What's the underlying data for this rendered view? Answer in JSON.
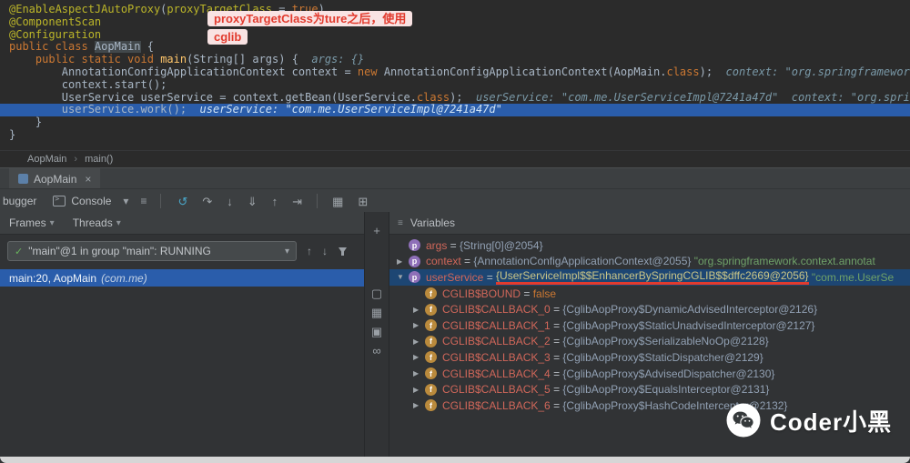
{
  "colors": {
    "current_line": "#2a5dab",
    "selected_row": "#1d4673",
    "annotation_red": "#e23b2e",
    "callout_bg": "#f9e3e3",
    "keyword_orange": "#cc7832",
    "annotation_yellow": "#bbb529",
    "var_name": "#d1675a"
  },
  "icons": {
    "chevron_down": "▾",
    "hamburger": "≡",
    "close": "×",
    "check": "✓",
    "up": "↑",
    "down": "↓"
  },
  "editor": {
    "current_line": 8,
    "lines": [
      [
        {
          "t": "@EnableAspectJAutoProxy",
          "c": "ann"
        },
        {
          "t": "(",
          "c": "plain"
        },
        {
          "t": "proxyTargetClass",
          "c": "ann"
        },
        {
          "t": " = ",
          "c": "plain"
        },
        {
          "t": "true",
          "c": "kw"
        },
        {
          "t": ")",
          "c": "plain"
        }
      ],
      [
        {
          "t": "@ComponentScan",
          "c": "ann"
        }
      ],
      [
        {
          "t": "@Configuration",
          "c": "ann"
        }
      ],
      [
        {
          "t": "public class ",
          "c": "kw"
        },
        {
          "t": "AopMain",
          "c": "plain hl"
        },
        {
          "t": " {",
          "c": "plain"
        }
      ],
      [
        {
          "t": "    ",
          "c": "plain"
        },
        {
          "t": "public static void ",
          "c": "kw"
        },
        {
          "t": "main",
          "c": "mth"
        },
        {
          "t": "(String[] args) {",
          "c": "plain"
        },
        {
          "t": "  args: {}",
          "c": "dbg"
        }
      ],
      [
        {
          "t": "        AnnotationConfigApplicationContext context = ",
          "c": "plain"
        },
        {
          "t": "new",
          "c": "kw"
        },
        {
          "t": " AnnotationConfigApplicationContext(AopMain.",
          "c": "plain"
        },
        {
          "t": "class",
          "c": "kw"
        },
        {
          "t": ");",
          "c": "plain"
        },
        {
          "t": "  context: \"org.springframework.context.annota",
          "c": "dbg"
        }
      ],
      [
        {
          "t": "        context.start();",
          "c": "plain"
        }
      ],
      [
        {
          "t": "        UserService userService = context.getBean(UserService.",
          "c": "plain"
        },
        {
          "t": "class",
          "c": "kw"
        },
        {
          "t": ");",
          "c": "plain"
        },
        {
          "t": "  userService: \"com.me.UserServiceImpl@7241a47d\"",
          "c": "dbg"
        },
        {
          "t": "  context: \"org.springframework.cont",
          "c": "dbg"
        }
      ],
      [
        {
          "t": "        userService.work();",
          "c": "plain"
        },
        {
          "t": "  userService: \"com.me.UserServiceImpl@7241a47d\"",
          "c": "dbgc"
        }
      ],
      [
        {
          "t": "    }",
          "c": "plain"
        }
      ],
      [
        {
          "t": "}",
          "c": "plain"
        }
      ]
    ],
    "callout": {
      "line1": "proxyTargetClass为ture之后，使用",
      "line2": "cglib"
    }
  },
  "breadcrumb": {
    "items": [
      "AopMain",
      "main()"
    ],
    "separator": "›"
  },
  "debug_tab": {
    "label": "AopMain"
  },
  "debug_toolbar": {
    "left_label": "bugger",
    "console_label": "Console",
    "icons": [
      {
        "name": "rerun-icon",
        "glyph": "↺",
        "color": "#49a6c8"
      },
      {
        "name": "step-over-icon",
        "glyph": "↷",
        "color": "#9fa5aa"
      },
      {
        "name": "step-into-icon",
        "glyph": "↓",
        "color": "#9fa5aa"
      },
      {
        "name": "force-step-into-icon",
        "glyph": "⇓",
        "color": "#9fa5aa"
      },
      {
        "name": "step-out-icon",
        "glyph": "↑",
        "color": "#9fa5aa"
      },
      {
        "name": "run-to-cursor-icon",
        "glyph": "⇥",
        "color": "#9fa5aa"
      },
      {
        "name": "toolbar-separator",
        "sep": true
      },
      {
        "name": "layout-grid-icon",
        "glyph": "▦",
        "color": "#9fa5aa"
      },
      {
        "name": "restore-layout-icon",
        "glyph": "⊞",
        "color": "#9fa5aa"
      }
    ]
  },
  "frames": {
    "tab_frames": "Frames",
    "tab_threads": "Threads",
    "thread_selector": "\"main\"@1 in group \"main\": RUNNING",
    "frame_label": "main:20, AopMain",
    "frame_package": "(com.me)"
  },
  "watches_toolbar": {
    "icons": [
      {
        "name": "add-watch-icon",
        "glyph": "+"
      },
      {
        "name": "monitor-icon",
        "glyph": "▢",
        "gap": 48
      },
      {
        "name": "grid-icon",
        "glyph": "▦"
      },
      {
        "name": "copy-icon",
        "glyph": "▣"
      },
      {
        "name": "watch-icon",
        "glyph": "∞"
      }
    ]
  },
  "variables": {
    "title": "Variables",
    "rows": [
      {
        "indent": 0,
        "expand": "none",
        "icon": "p",
        "name": "args",
        "value": [
          {
            "t": "{String[0]@2054}",
            "c": "obj"
          }
        ]
      },
      {
        "indent": 0,
        "expand": "right",
        "icon": "p",
        "name": "context",
        "value": [
          {
            "t": "{AnnotationConfigApplicationContext@2055} ",
            "c": "obj"
          },
          {
            "t": "\"org.springframework.context.annotat",
            "c": "str"
          }
        ]
      },
      {
        "indent": 0,
        "expand": "down",
        "icon": "p",
        "name": "userService",
        "selected": true,
        "value": [
          {
            "t": "{UserServiceImpl$$EnhancerBySpringCGLIB$$dffc2669@2056}",
            "c": "obj sel-val underline"
          },
          {
            "t": " ",
            "c": "obj"
          },
          {
            "t": "\"com.me.UserSe",
            "c": "str"
          }
        ]
      },
      {
        "indent": 1,
        "expand": "none",
        "icon": "f",
        "name": "CGLIB$BOUND",
        "value": [
          {
            "t": "false",
            "c": "kw"
          }
        ]
      },
      {
        "indent": 1,
        "expand": "right",
        "icon": "f",
        "name": "CGLIB$CALLBACK_0",
        "value": [
          {
            "t": "{CglibAopProxy$DynamicAdvisedInterceptor@2126}",
            "c": "obj"
          }
        ]
      },
      {
        "indent": 1,
        "expand": "right",
        "icon": "f",
        "name": "CGLIB$CALLBACK_1",
        "value": [
          {
            "t": "{CglibAopProxy$StaticUnadvisedInterceptor@2127}",
            "c": "obj"
          }
        ]
      },
      {
        "indent": 1,
        "expand": "right",
        "icon": "f",
        "name": "CGLIB$CALLBACK_2",
        "value": [
          {
            "t": "{CglibAopProxy$SerializableNoOp@2128}",
            "c": "obj"
          }
        ]
      },
      {
        "indent": 1,
        "expand": "right",
        "icon": "f",
        "name": "CGLIB$CALLBACK_3",
        "value": [
          {
            "t": "{CglibAopProxy$StaticDispatcher@2129}",
            "c": "obj"
          }
        ]
      },
      {
        "indent": 1,
        "expand": "right",
        "icon": "f",
        "name": "CGLIB$CALLBACK_4",
        "value": [
          {
            "t": "{CglibAopProxy$AdvisedDispatcher@2130}",
            "c": "obj"
          }
        ]
      },
      {
        "indent": 1,
        "expand": "right",
        "icon": "f",
        "name": "CGLIB$CALLBACK_5",
        "value": [
          {
            "t": "{CglibAopProxy$EqualsInterceptor@2131}",
            "c": "obj"
          }
        ]
      },
      {
        "indent": 1,
        "expand": "right",
        "icon": "f",
        "name": "CGLIB$CALLBACK_6",
        "value": [
          {
            "t": "{CglibAopProxy$HashCodeInterceptor@2132}",
            "c": "obj"
          }
        ]
      }
    ]
  },
  "watermark": {
    "text": "Coder小黑"
  }
}
